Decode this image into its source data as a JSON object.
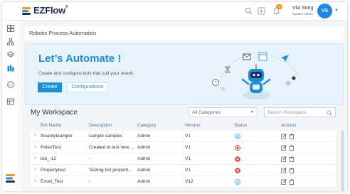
{
  "app": {
    "logo_text": "EZFlow",
    "logo_mark": "®"
  },
  "topbar": {
    "notification_count": "99",
    "user_name": "Vivi Song",
    "user_role": "System Admin",
    "avatar_initials": "VS"
  },
  "breadcrumb": {
    "title": "Robotic Process Automation"
  },
  "hero": {
    "title": "Let’s Automate !",
    "subtitle": "Create and configure bots that suit your needs",
    "create_label": "Create",
    "config_label": "Configurations"
  },
  "workspace": {
    "title": "My Workspace",
    "category_selected": "All Categories",
    "search_placeholder": "Search Workspace"
  },
  "table": {
    "headers": [
      "Bot Name",
      "Description",
      "Category",
      "Version",
      "Status",
      "Actions"
    ],
    "rows": [
      {
        "name": "theampleample",
        "description": "sample samples",
        "category": "Admin",
        "version": "V1",
        "status": "pending"
      },
      {
        "name": "PolenTest",
        "description": "Created to test new ...",
        "category": "Admin",
        "version": "V1",
        "status": "stopped"
      },
      {
        "name": "bot_-12",
        "description": "-",
        "category": "Admin",
        "version": "V1",
        "status": "error"
      },
      {
        "name": "Propertytest",
        "description": "Testing bot properti...",
        "category": "Admin",
        "version": "V1",
        "status": "error"
      },
      {
        "name": "Excel_Test",
        "description": "-",
        "category": "Admin",
        "version": "V12",
        "status": "pending"
      }
    ]
  },
  "colors": {
    "accent": "#1c8fd8",
    "brand_dark": "#1f2d5c",
    "brand_orange": "#f7941d",
    "status_error": "#e53935",
    "status_pending": "#4aa3df"
  }
}
